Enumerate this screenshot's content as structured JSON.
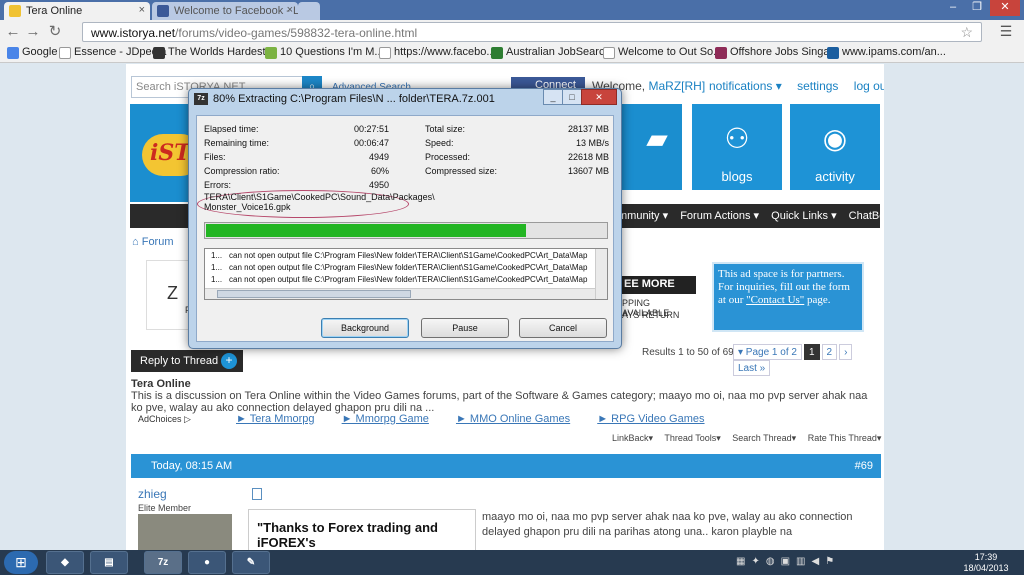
{
  "browser": {
    "tabs": [
      {
        "title": "Tera Online",
        "active": true
      },
      {
        "title": "Welcome to Facebook - L",
        "active": false
      }
    ],
    "url_host": "www.istorya.net",
    "url_path": "/forums/video-games/598832-tera-online.html",
    "bookmarks": [
      "Google",
      "Essence - JDpedia",
      "The Worlds Hardest ...",
      "10 Questions I'm M...",
      "https://www.facebo...",
      "Australian JobSearc...",
      "Welcome to Out So...",
      "Offshore Jobs Singa...",
      "www.ipams.com/an..."
    ]
  },
  "site": {
    "search_placeholder": "Search iSTORYA.NET",
    "advanced_search": "Advanced Search",
    "connect": "Connect",
    "welcome_label": "Welcome,",
    "username": "MaRZ[RH]",
    "top_links": [
      "notifications ▾",
      "settings",
      "log out"
    ],
    "tiles": [
      {
        "label": "ums",
        "glyph": "◼"
      },
      {
        "label": "blogs",
        "glyph": "⚇"
      },
      {
        "label": "activity",
        "glyph": "◉"
      }
    ],
    "nav_items": [
      "mmunity ▾",
      "Forum Actions ▾",
      "Quick Links ▾",
      "ChatBox"
    ],
    "breadcrumb": "Forum",
    "ad_left_line1": "Z A",
    "ad_left_line2": "PH",
    "ad_mid_line1": "EE MORE",
    "ad_mid_line2": "PPING AVAILABLE",
    "ad_mid_line3": "AYS RETURN",
    "ad_blue_text": "This ad space is for partners. For inquiries, fill out the form at our",
    "ad_blue_link": "\"Contact Us\"",
    "ad_blue_end": "page.",
    "results": "Results 1 to 50 of 69",
    "pager": [
      "▾ Page 1 of 2",
      "1",
      "2",
      "›",
      "Last »"
    ],
    "reply_label": "Reply to Thread",
    "thread_title": "Tera Online",
    "thread_desc": "This is a discussion on Tera Online within the Video Games forums, part of the Software & Games category; maayo mo oi, naa mo pvp server ahak naa ko pve, walay au ako connection delayed ghapon pru dili na ...",
    "adchoices": "AdChoices",
    "ad_links": [
      "► Tera Mmorpg",
      "► Mmorpg Game",
      "► MMO Online Games",
      "► RPG Video Games"
    ],
    "thread_tools": [
      "LinkBack▾",
      "Thread Tools▾",
      "Search Thread▾",
      "Rate This Thread▾"
    ],
    "post_date": "Today, 08:15 AM",
    "post_number": "#69",
    "post_user": "zhieg",
    "post_user_title": "Elite Member",
    "forex_ad": "\"Thanks to Forex trading and iFOREX's",
    "post_text": "maayo mo oi, naa mo pvp server ahak naa ko pve, walay au ako connection delayed ghapon pru dili na parihas atong una.. karon playble na"
  },
  "dialog": {
    "title": "80% Extracting C:\\Program Files\\N ... folder\\TERA.7z.001",
    "stats_left": [
      {
        "label": "Elapsed time:",
        "value": "00:27:51"
      },
      {
        "label": "Remaining time:",
        "value": "00:06:47"
      },
      {
        "label": "Files:",
        "value": "4949"
      },
      {
        "label": "Compression ratio:",
        "value": "60%"
      },
      {
        "label": "Errors:",
        "value": "4950"
      }
    ],
    "stats_right": [
      {
        "label": "Total size:",
        "value": "28137 MB"
      },
      {
        "label": "Speed:",
        "value": "13 MB/s"
      },
      {
        "label": "Processed:",
        "value": "22618 MB"
      },
      {
        "label": "Compressed size:",
        "value": "13607 MB"
      }
    ],
    "current_file_line1": "TERA\\Client\\S1Game\\CookedPC\\Sound_Data\\Packages\\",
    "current_file_line2": "Monster_Voice16.gpk",
    "progress_percent": 80,
    "log_lines": [
      {
        "n": "1...",
        "text": "can not open output file C:\\Program Files\\New folder\\TERA\\Client\\S1Game\\CookedPC\\Art_Data\\Map"
      },
      {
        "n": "1...",
        "text": "can not open output file C:\\Program Files\\New folder\\TERA\\Client\\S1Game\\CookedPC\\Art_Data\\Map"
      },
      {
        "n": "1...",
        "text": "can not open output file C:\\Program Files\\New folder\\TERA\\Client\\S1Game\\CookedPC\\Art_Data\\Map"
      }
    ],
    "buttons": [
      "Background",
      "Pause",
      "Cancel"
    ]
  },
  "taskbar": {
    "apps": [
      "7z"
    ],
    "time": "17:39",
    "date": "18/04/2013"
  }
}
